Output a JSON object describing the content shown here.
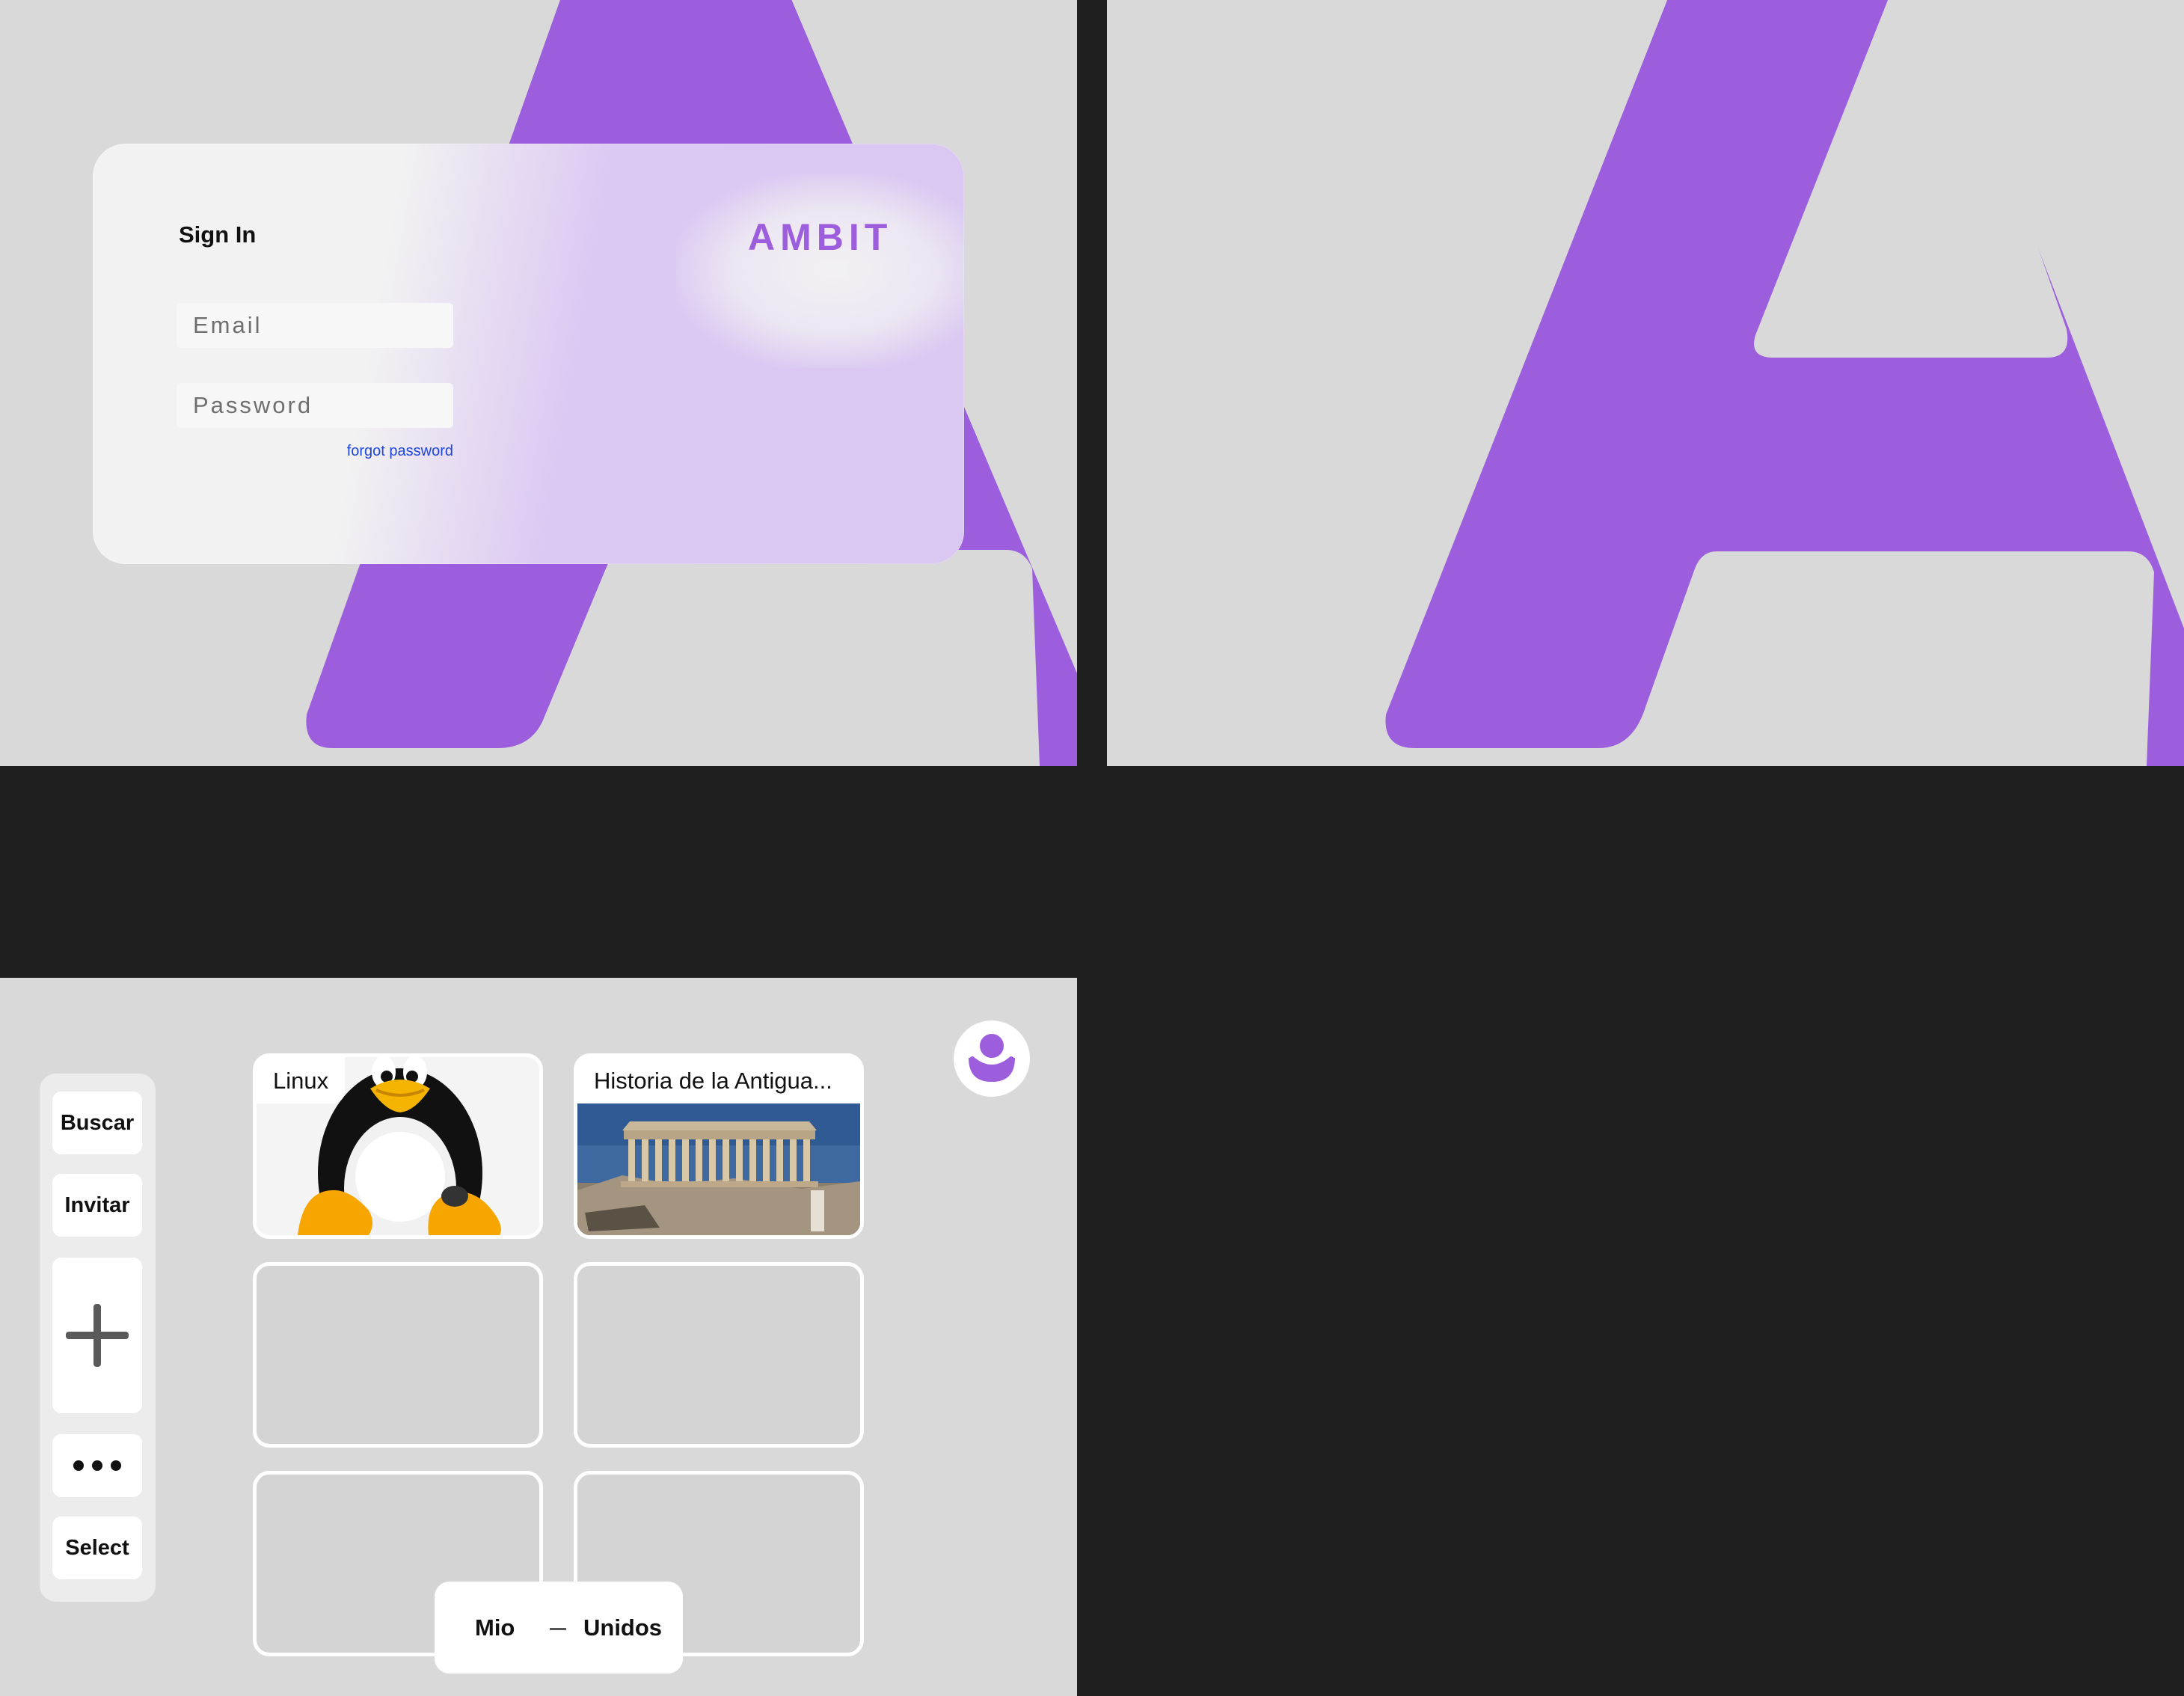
{
  "colors": {
    "accent": "#9c5edc",
    "frame_bg": "#d9d9d9",
    "canvas_bg": "#1f1f1f",
    "link": "#2047d8"
  },
  "login": {
    "title": "Sign In",
    "brand": "AMBIT",
    "email_placeholder": "Email",
    "password_placeholder": "Password",
    "forgot_label": "forgot password"
  },
  "home": {
    "sidebar": {
      "search_label": "Buscar",
      "invite_label": "Invitar",
      "add_icon": "plus-icon",
      "more_icon": "more-horizontal-icon",
      "select_label": "Select"
    },
    "cards": [
      {
        "label": "Linux",
        "image": "linux-penguin-image"
      },
      {
        "label": "Historia de la Antigua...",
        "image": "parthenon-image"
      }
    ],
    "avatar_icon": "user-avatar-icon",
    "tabs": {
      "mine": "Mio",
      "joined": "Unidos"
    }
  }
}
